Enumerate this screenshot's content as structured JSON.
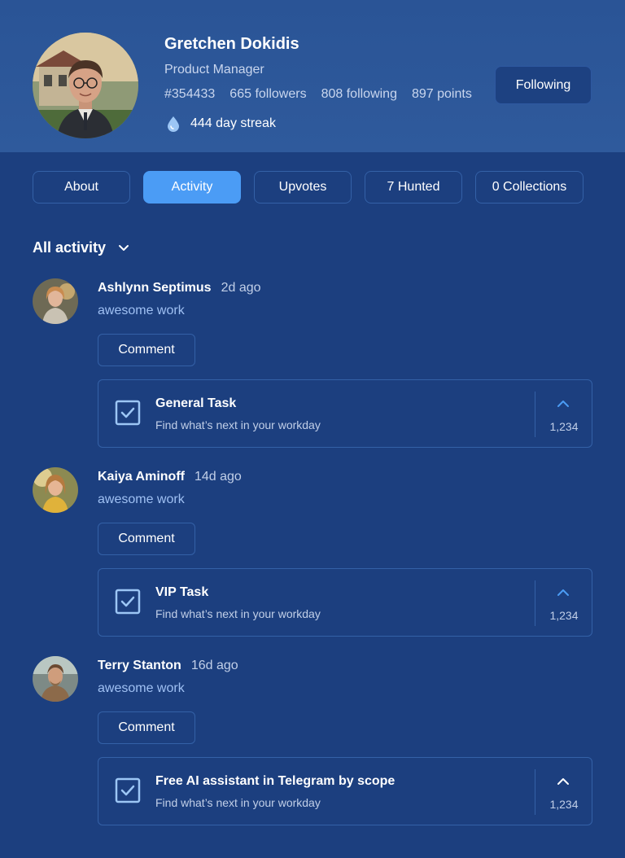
{
  "profile": {
    "name": "Gretchen Dokidis",
    "role": "Product Manager",
    "id": "#354433",
    "followers": "665 followers",
    "following": "808 following",
    "points": "897 points",
    "streak": "444 day streak",
    "follow_button": "Following"
  },
  "tabs": [
    {
      "label": "About",
      "active": false
    },
    {
      "label": "Activity",
      "active": true
    },
    {
      "label": "Upvotes",
      "active": false
    },
    {
      "label": "7 Hunted",
      "active": false
    },
    {
      "label": "0 Collections",
      "active": false
    }
  ],
  "filter": {
    "label": "All activity"
  },
  "activities": [
    {
      "user": "Ashlynn Septimus",
      "time": "2d ago",
      "text": "awesome work",
      "comment_label": "Comment",
      "product": {
        "title": "General Task",
        "subtitle": "Find what’s next in your workday",
        "votes": "1,234"
      }
    },
    {
      "user": "Kaiya Aminoff",
      "time": "14d ago",
      "text": "awesome work",
      "comment_label": "Comment",
      "product": {
        "title": "VIP Task",
        "subtitle": "Find what’s next in your workday",
        "votes": "1,234"
      }
    },
    {
      "user": "Terry Stanton",
      "time": "16d ago",
      "text": "awesome work",
      "comment_label": "Comment",
      "product": {
        "title": "Free AI assistant in Telegram by scope",
        "subtitle": "Find what’s next in your workday",
        "votes": "1,234"
      }
    }
  ],
  "icons": {
    "streak": "drop-icon",
    "filter": "chevron-down-icon",
    "product": "checkbox-icon",
    "upvote": "chevron-up-icon"
  },
  "colors": {
    "background": "#1c3f7f",
    "header": "#2a5496",
    "accent": "#4b9cf5",
    "border": "#3461a7"
  }
}
